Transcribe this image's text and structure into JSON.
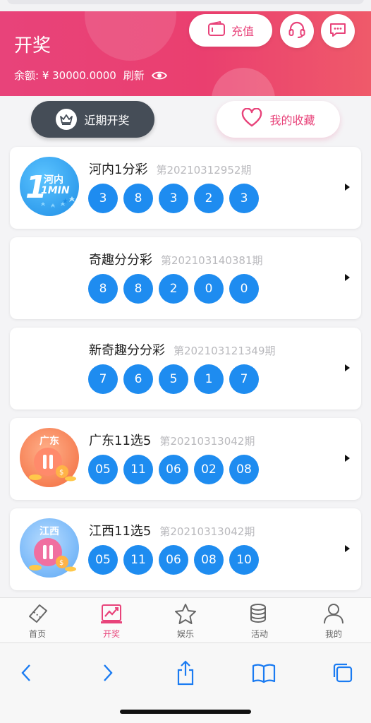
{
  "header": {
    "title": "开奖",
    "balance_text": "余额: ¥ 30000.0000",
    "refresh_label": "刷新",
    "recharge_label": "充值"
  },
  "segments": {
    "recent_label": "近期开奖",
    "favorites_label": "我的收藏"
  },
  "lotteries": [
    {
      "name": "河内1分彩",
      "period": "第20210312952期",
      "balls": [
        "3",
        "8",
        "3",
        "2",
        "3"
      ],
      "logo": "hanoi-1min-logo",
      "logo_text": "河内",
      "logo_sub": "1MIN"
    },
    {
      "name": "奇趣分分彩",
      "period": "第202103140381期",
      "balls": [
        "8",
        "8",
        "2",
        "0",
        "0"
      ],
      "logo": ""
    },
    {
      "name": "新奇趣分分彩",
      "period": "第202103121349期",
      "balls": [
        "7",
        "6",
        "5",
        "1",
        "7"
      ],
      "logo": ""
    },
    {
      "name": "广东11选5",
      "period": "第20210313042期",
      "balls": [
        "05",
        "11",
        "06",
        "02",
        "08"
      ],
      "logo": "guangdong-11x5-logo",
      "logo_text": "广东"
    },
    {
      "name": "江西11选5",
      "period": "第20210313042期",
      "balls": [
        "05",
        "11",
        "06",
        "08",
        "10"
      ],
      "logo": "jiangxi-11x5-logo",
      "logo_text": "江西"
    }
  ],
  "tabs": [
    {
      "label": "首页",
      "icon": "ticket-icon"
    },
    {
      "label": "开奖",
      "icon": "chart-icon",
      "active": true
    },
    {
      "label": "娱乐",
      "icon": "star-icon"
    },
    {
      "label": "活动",
      "icon": "coins-icon"
    },
    {
      "label": "我的",
      "icon": "user-icon"
    }
  ],
  "colors": {
    "brand": "#e8437a",
    "ball": "#1e8cf0",
    "dark_segment": "#454d57"
  }
}
